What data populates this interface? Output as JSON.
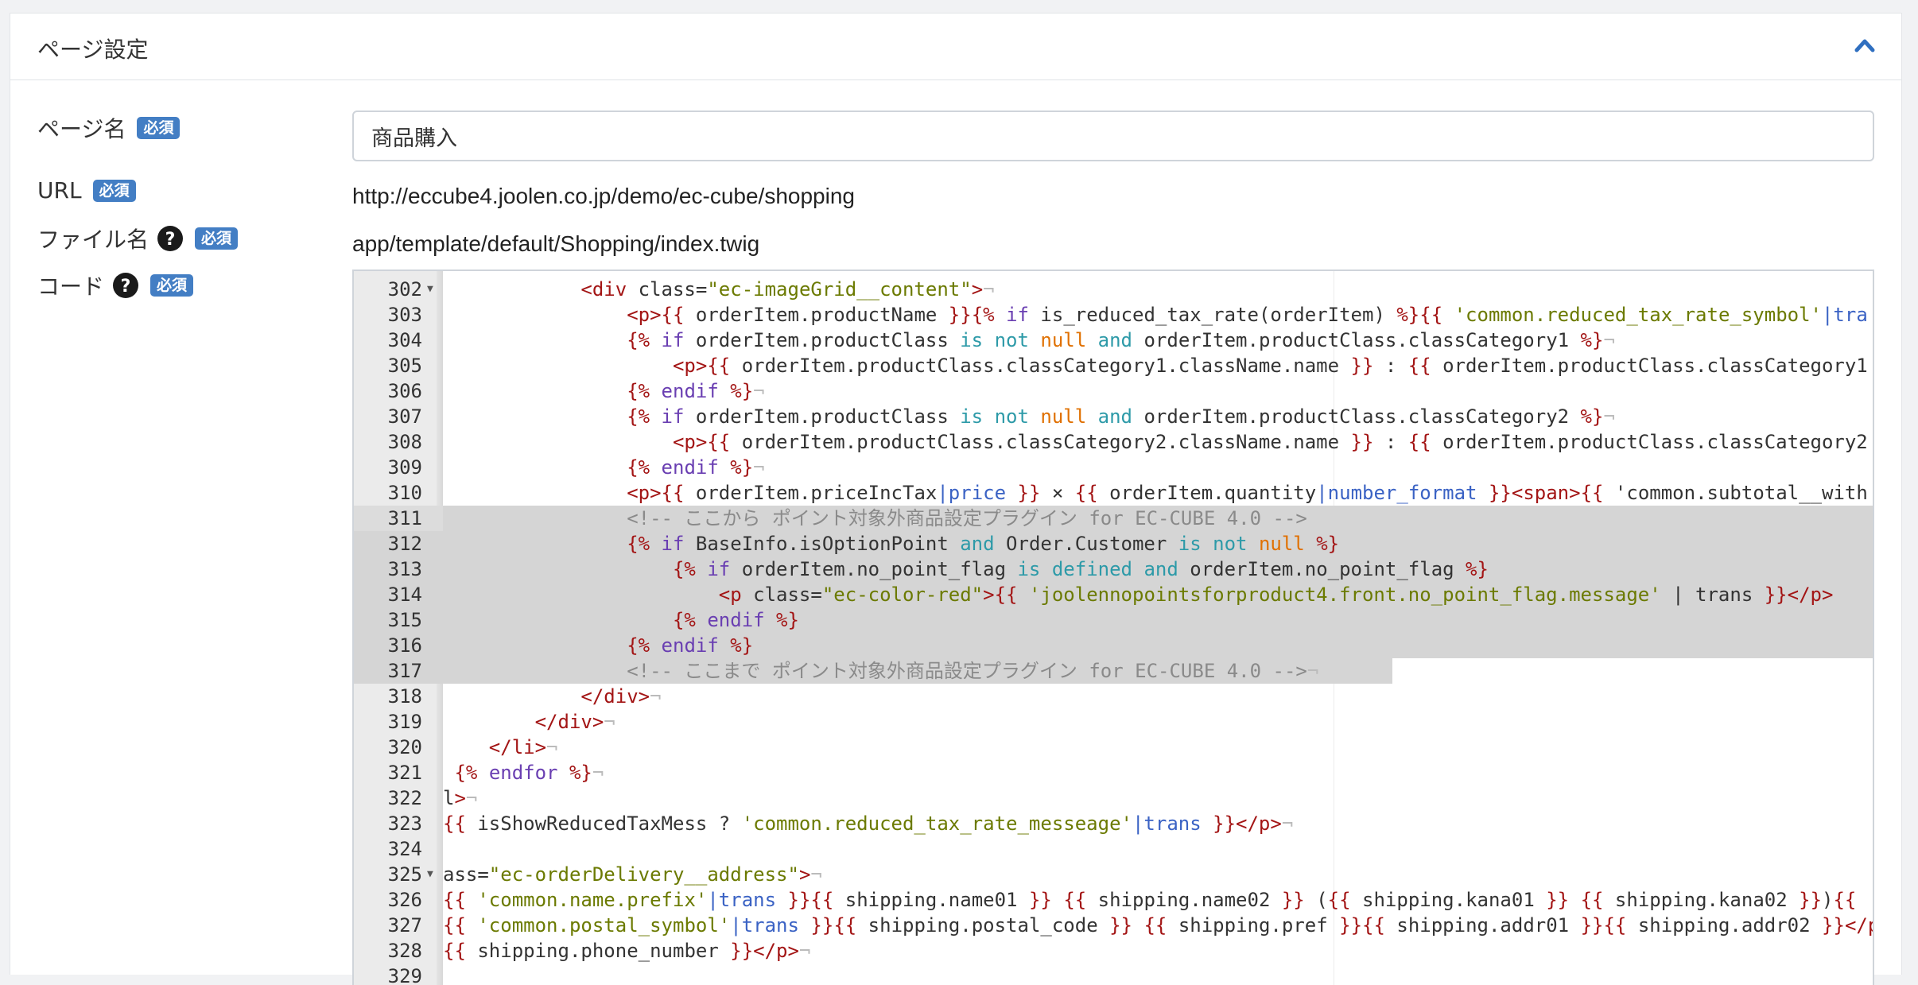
{
  "section": {
    "title": "ページ設定",
    "collapse_icon": "chevron-up-icon"
  },
  "labels": {
    "page_name": "ページ名",
    "url": "URL",
    "file_name": "ファイル名",
    "code": "コード",
    "required": "必須"
  },
  "fields": {
    "page_name_value": "商品購入",
    "url_value": "http://eccube4.joolen.co.jp/demo/ec-cube/shopping",
    "file_name_value": "app/template/default/Shopping/index.twig"
  },
  "colors": {
    "tag": "#a31515",
    "attr": "#c23c7e",
    "string": "#6b7a00",
    "keyword": "#6a3fb2",
    "operator": "#2d9aa8",
    "constant": "#e07000",
    "comment": "#8a8a8a",
    "filter": "#3a62c4",
    "badge": "#437ec4"
  },
  "editor": {
    "lines": [
      {
        "num": "302",
        "fold": true,
        "text": "            <div class=\"ec-imageGrid__content\">¬"
      },
      {
        "num": "303",
        "fold": false,
        "text": "                <p>{{ orderItem.productName }}{% if is_reduced_tax_rate(orderItem) %}{{ 'common.reduced_tax_rate_symbol'|tra"
      },
      {
        "num": "304",
        "fold": false,
        "text": "                {% if orderItem.productClass is not null and orderItem.productClass.classCategory1 %}¬"
      },
      {
        "num": "305",
        "fold": false,
        "text": "                    <p>{{ orderItem.productClass.classCategory1.className.name }} : {{ orderItem.productClass.classCategory1"
      },
      {
        "num": "306",
        "fold": false,
        "text": "                {% endif %}¬"
      },
      {
        "num": "307",
        "fold": false,
        "text": "                {% if orderItem.productClass is not null and orderItem.productClass.classCategory2 %}¬"
      },
      {
        "num": "308",
        "fold": false,
        "text": "                    <p>{{ orderItem.productClass.classCategory2.className.name }} : {{ orderItem.productClass.classCategory2"
      },
      {
        "num": "309",
        "fold": false,
        "text": "                {% endif %}¬"
      },
      {
        "num": "310",
        "fold": false,
        "text": "                <p>{{ orderItem.priceIncTax|price }} × {{ orderItem.quantity|number_format }}<span>{{ 'common.subtotal__with"
      },
      {
        "num": "311",
        "fold": false,
        "text": "                <!-- ここから ポイント対象外商品設定プラグイン for EC-CUBE 4.0 -->"
      },
      {
        "num": "312",
        "fold": false,
        "text": "                {% if BaseInfo.isOptionPoint and Order.Customer is not null %}"
      },
      {
        "num": "313",
        "fold": false,
        "text": "                    {% if orderItem.no_point_flag is defined and orderItem.no_point_flag %}"
      },
      {
        "num": "314",
        "fold": false,
        "text": "                        <p class=\"ec-color-red\">{{ 'joolennopointsforproduct4.front.no_point_flag.message' | trans }}</p>"
      },
      {
        "num": "315",
        "fold": false,
        "text": "                    {% endif %}"
      },
      {
        "num": "316",
        "fold": false,
        "text": "                {% endif %}"
      },
      {
        "num": "317",
        "fold": false,
        "text": "                <!-- ここまで ポイント対象外商品設定プラグイン for EC-CUBE 4.0 -->¬"
      },
      {
        "num": "318",
        "fold": false,
        "text": "            </div>¬"
      },
      {
        "num": "319",
        "fold": false,
        "text": "        </div>¬"
      },
      {
        "num": "320",
        "fold": false,
        "text": "    </li>¬"
      },
      {
        "num": "321",
        "fold": false,
        "text": " {% endfor %}¬"
      },
      {
        "num": "322",
        "fold": false,
        "text": "l>¬"
      },
      {
        "num": "323",
        "fold": false,
        "text": "{{ isShowReducedTaxMess ? 'common.reduced_tax_rate_messeage'|trans }}</p>¬"
      },
      {
        "num": "324",
        "fold": false,
        "text": ""
      },
      {
        "num": "325",
        "fold": true,
        "text": "ass=\"ec-orderDelivery__address\">¬"
      },
      {
        "num": "326",
        "fold": false,
        "text": "{{ 'common.name.prefix'|trans }}{{ shipping.name01 }} {{ shipping.name02 }} ({{ shipping.kana01 }} {{ shipping.kana02 }}){{ '"
      },
      {
        "num": "327",
        "fold": false,
        "text": "{{ 'common.postal_symbol'|trans }}{{ shipping.postal_code }} {{ shipping.pref }}{{ shipping.addr01 }}{{ shipping.addr02 }}</p"
      },
      {
        "num": "328",
        "fold": false,
        "text": "{{ shipping.phone_number }}</p>¬"
      },
      {
        "num": "329",
        "fold": false,
        "text": ""
      }
    ]
  }
}
